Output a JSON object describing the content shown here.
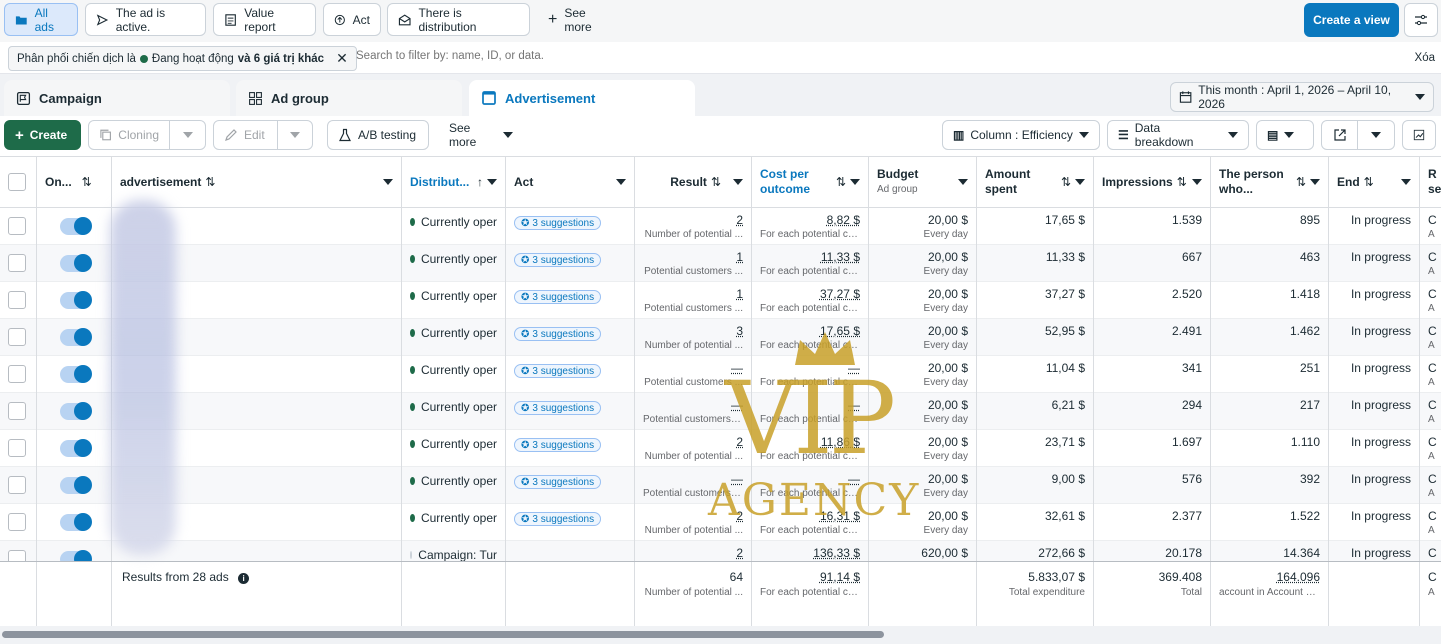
{
  "top_nav": {
    "all_ads": "All ads",
    "ad_active": "The ad is active.",
    "value_report": "Value report",
    "act": "Act",
    "distribution": "There is distribution",
    "see_more": "See more",
    "create_view": "Create a view"
  },
  "filter": {
    "chip_prefix": "Phân phối chiến dịch là",
    "chip_value": "Đang hoạt động",
    "chip_suffix": "và 6 giá trị khác",
    "placeholder": "Search to filter by: name, ID, or data.",
    "clear": "Xóa"
  },
  "tabs": {
    "campaign": "Campaign",
    "ad_group": "Ad group",
    "advertisement": "Advertisement"
  },
  "date_range": "This month : April 1, 2026 – April 10, 2026",
  "toolbar": {
    "create": "Create",
    "cloning": "Cloning",
    "edit": "Edit",
    "ab_testing": "A/B testing",
    "see_more": "See more",
    "columns": "Column : Efficiency",
    "breakdown": "Data breakdown"
  },
  "headers": {
    "on_off": "On...",
    "advertisement": "advertisement",
    "distribution": "Distribut...",
    "act": "Act",
    "result": "Result",
    "cost_line1": "Cost per",
    "cost_line2": "outcome",
    "budget": "Budget",
    "budget_sub": "Ad group",
    "amount_line1": "Amount",
    "amount_line2": "spent",
    "impressions": "Impressions",
    "person_line1": "The person",
    "person_line2": "who...",
    "end": "End",
    "extra_line1": "R",
    "extra_line2": "se"
  },
  "rows": [
    {
      "status": "Currently oper",
      "sugg": "3 suggestions",
      "result": "2",
      "result_sub": "Number of potential ...",
      "cost": "8,82 $",
      "cost_sub": "For each potential cu...",
      "budget": "20,00 $",
      "budget_sub": "Every day",
      "spent": "17,65 $",
      "impr": "1.539",
      "person": "895",
      "end": "In progress",
      "extra": "C",
      "extra_sub": "A"
    },
    {
      "status": "Currently oper",
      "sugg": "3 suggestions",
      "result": "1",
      "result_sub": "Potential customers ...",
      "cost": "11,33 $",
      "cost_sub": "For each potential cu...",
      "budget": "20,00 $",
      "budget_sub": "Every day",
      "spent": "11,33 $",
      "impr": "667",
      "person": "463",
      "end": "In progress",
      "extra": "C",
      "extra_sub": "A"
    },
    {
      "status": "Currently oper",
      "sugg": "3 suggestions",
      "result": "1",
      "result_sub": "Potential customers ...",
      "cost": "37,27 $",
      "cost_sub": "For each potential cu...",
      "budget": "20,00 $",
      "budget_sub": "Every day",
      "spent": "37,27 $",
      "impr": "2.520",
      "person": "1.418",
      "end": "In progress",
      "extra": "C",
      "extra_sub": "A"
    },
    {
      "status": "Currently oper",
      "sugg": "3 suggestions",
      "result": "3",
      "result_sub": "Number of potential ...",
      "cost": "17,65 $",
      "cost_sub": "For each potential cu...",
      "budget": "20,00 $",
      "budget_sub": "Every day",
      "spent": "52,95 $",
      "impr": "2.491",
      "person": "1.462",
      "end": "In progress",
      "extra": "C",
      "extra_sub": "A"
    },
    {
      "status": "Currently oper",
      "sugg": "3 suggestions",
      "result": "—",
      "result_sub": "Potential customers ...",
      "cost": "—",
      "cost_sub": "For each potential cu...",
      "budget": "20,00 $",
      "budget_sub": "Every day",
      "spent": "11,04 $",
      "impr": "341",
      "person": "251",
      "end": "In progress",
      "extra": "C",
      "extra_sub": "A"
    },
    {
      "status": "Currently oper",
      "sugg": "3 suggestions",
      "result": "—",
      "result_sub": "Potential customers o...",
      "cost": "—",
      "cost_sub": "For each potential cu...",
      "budget": "20,00 $",
      "budget_sub": "Every day",
      "spent": "6,21 $",
      "impr": "294",
      "person": "217",
      "end": "In progress",
      "extra": "C",
      "extra_sub": "A"
    },
    {
      "status": "Currently oper",
      "sugg": "3 suggestions",
      "result": "2",
      "result_sub": "Number of potential ...",
      "cost": "11,86 $",
      "cost_sub": "For each potential cu...",
      "budget": "20,00 $",
      "budget_sub": "Every day",
      "spent": "23,71 $",
      "impr": "1.697",
      "person": "1.110",
      "end": "In progress",
      "extra": "C",
      "extra_sub": "A"
    },
    {
      "status": "Currently oper",
      "sugg": "3 suggestions",
      "result": "—",
      "result_sub": "Potential customers o...",
      "cost": "—",
      "cost_sub": "For each potential cu...",
      "budget": "20,00 $",
      "budget_sub": "Every day",
      "spent": "9,00 $",
      "impr": "576",
      "person": "392",
      "end": "In progress",
      "extra": "C",
      "extra_sub": "A"
    },
    {
      "status": "Currently oper",
      "sugg": "3 suggestions",
      "result": "2",
      "result_sub": "Number of potential ...",
      "cost": "16,31 $",
      "cost_sub": "For each potential cu...",
      "budget": "20,00 $",
      "budget_sub": "Every day",
      "spent": "32,61 $",
      "impr": "2.377",
      "person": "1.522",
      "end": "In progress",
      "extra": "C",
      "extra_sub": "A"
    },
    {
      "status": "Campaign: Tur",
      "sugg": "",
      "result": "2",
      "result_sub": "",
      "cost": "136,33 $",
      "cost_sub": "",
      "budget": "620,00 $",
      "budget_sub": "",
      "spent": "272,66 $",
      "impr": "20.178",
      "person": "14.364",
      "end": "In progress",
      "extra": "C",
      "extra_sub": ""
    }
  ],
  "totals": {
    "label": "Results from 28 ads",
    "result": "64",
    "result_sub": "Number of potential ...",
    "cost": "91,14 $",
    "cost_sub": "For each potential cu...",
    "spent": "5.833,07 $",
    "spent_sub": "Total expenditure",
    "impr": "369.408",
    "impr_sub": "Total",
    "person": "164.096",
    "person_sub": "account in Account C...",
    "extra": "C",
    "extra_sub": "A"
  },
  "watermark": {
    "line1": "VIP",
    "line2": "AGENCY"
  },
  "colors": {
    "accent": "#0a78be",
    "active_dot": "#1e6b49",
    "primary_button": "#0a78be",
    "create_button": "#1e6b49"
  }
}
